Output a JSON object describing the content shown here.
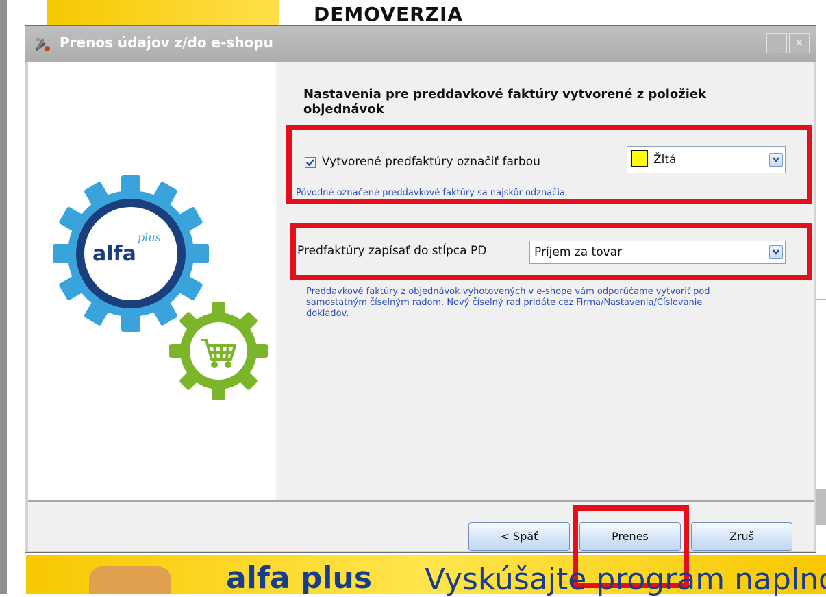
{
  "background": {
    "header_title": "DEMOVERZIA",
    "banner_logo": "alfa plus",
    "banner_text": "Vyskúšajte program naplno!"
  },
  "dialog": {
    "title": "Prenos údajov z/do e-shopu",
    "minimize_symbol": "_",
    "close_symbol": "✕",
    "logo_text": "alfa",
    "logo_sup": "plus",
    "heading": "Nastavenia pre preddavkové faktúry vytvorené z položiek objednávok",
    "mark_color": {
      "checked": true,
      "label": "Vytvorené predfaktúry označiť farbou",
      "selected_color_name": "Žltá",
      "selected_color": "#ffff00",
      "note": "Pôvodné označené preddavkové faktúry sa najskôr odznačia."
    },
    "pd_column": {
      "label": "Predfaktúry zapísať do stĺpca PD",
      "selected": "Príjem za tovar"
    },
    "info_text": "Preddavkové faktúry z objednávok vyhotovených v e-shope vám odporúčame vytvoriť pod samostatným číselným radom. Nový číselný rad pridáte cez Firma/Nastavenia/Číslovanie dokladov.",
    "buttons": {
      "back": "< Späť",
      "transfer": "Prenes",
      "cancel": "Zruš"
    }
  },
  "colors": {
    "highlight_red": "#e3101c",
    "note_blue": "#2a4fc0",
    "gear_blue": "#3aa3dc",
    "gear_navy": "#1b3f7c",
    "gear_green": "#7cb52a"
  }
}
